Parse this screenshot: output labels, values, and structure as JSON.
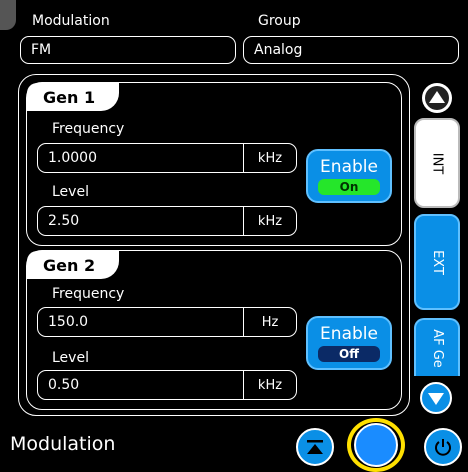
{
  "header": {
    "modulation_label": "Modulation",
    "modulation_value": "FM",
    "group_label": "Group",
    "group_value": "Analog"
  },
  "gen1": {
    "title": "Gen 1",
    "frequency_label": "Frequency",
    "frequency_value": "1.0000",
    "frequency_unit": "kHz",
    "level_label": "Level",
    "level_value": "2.50",
    "level_unit": "kHz",
    "enable_label": "Enable",
    "enable_state": "On"
  },
  "gen2": {
    "title": "Gen 2",
    "frequency_label": "Frequency",
    "frequency_value": "150.0",
    "frequency_unit": "Hz",
    "level_label": "Level",
    "level_value": "0.50",
    "level_unit": "kHz",
    "enable_label": "Enable",
    "enable_state": "Off"
  },
  "side_tabs": [
    {
      "label": "INT",
      "selected": true
    },
    {
      "label": "EXT",
      "selected": false
    },
    {
      "label": "AF Ge",
      "selected": false
    }
  ],
  "footer": {
    "title": "Modulation"
  },
  "colors": {
    "accent_blue": "#0a8fe6",
    "on_green": "#25e62a",
    "highlight_yellow": "#ffe000"
  },
  "icons": [
    "scroll-up-icon",
    "scroll-down-icon",
    "collapse-up-icon",
    "power-icon"
  ]
}
